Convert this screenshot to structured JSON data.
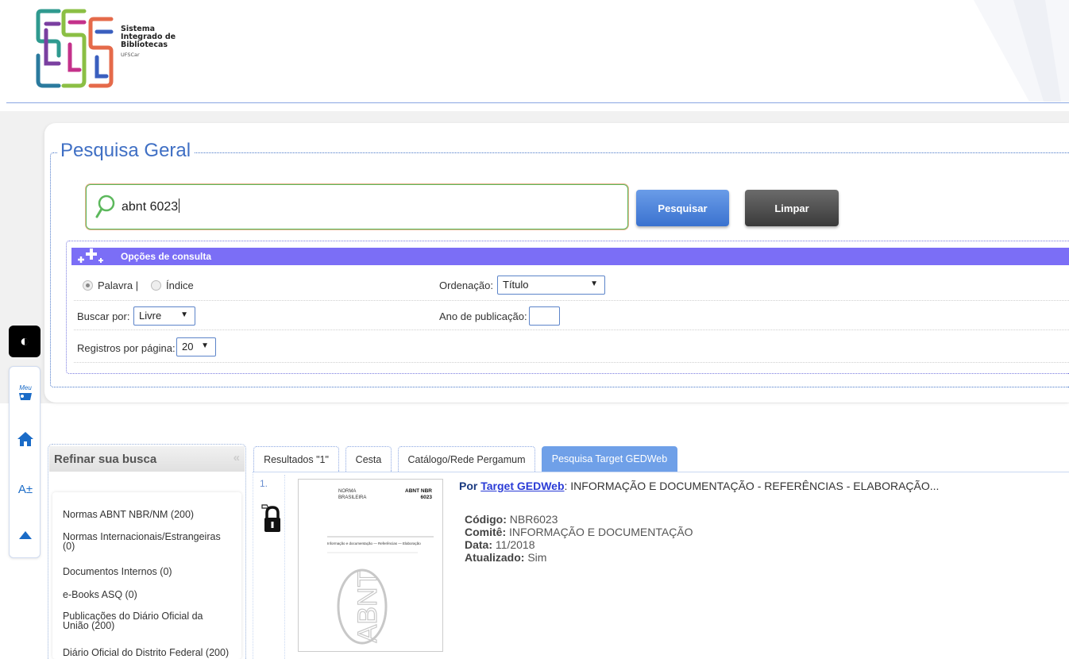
{
  "header": {
    "logo_lines": [
      "Sistema",
      "Integrado de",
      "Bibliotecas"
    ],
    "logo_sub": "UFSCar"
  },
  "search": {
    "legend": "Pesquisa Geral",
    "query": "abnt 6023",
    "search_button": "Pesquisar",
    "clear_button": "Limpar"
  },
  "options": {
    "title": "Opções de consulta",
    "radio_word": "Palavra |",
    "radio_index": "Índice",
    "radio_selected": "Palavra",
    "order_label": "Ordenação:",
    "order_value": "Título",
    "search_by_label": "Buscar por:",
    "search_by_value": "Livre",
    "year_label": "Ano de publicação:",
    "year_value": "",
    "per_page_label": "Registros por página:",
    "per_page_value": "20"
  },
  "toolbar": {
    "contrast": "◐",
    "menu": "Meu",
    "font_size": "A±"
  },
  "refine": {
    "title": "Refinar sua busca",
    "items": [
      "Normas ABNT NBR/NM (200)",
      "Normas Internacionais/Estrangeiras (0)",
      "Documentos Internos (0)",
      "e-Books ASQ (0)",
      "Publicações do Diário Oficial da União (200)",
      "Diário Oficial do Distrito Federal (200)"
    ]
  },
  "tabs": [
    {
      "label": "Resultados \"1\"",
      "active": false
    },
    {
      "label": "Cesta",
      "active": false
    },
    {
      "label": "Catálogo/Rede Pergamum",
      "active": false
    },
    {
      "label": "Pesquisa Target GEDWeb",
      "active": true
    }
  ],
  "result": {
    "number": "1.",
    "by_label": "Por",
    "source_link": "Target GEDWeb",
    "title_rest": ": INFORMAÇÃO E DOCUMENTAÇÃO - REFERÊNCIAS - ELABORAÇÃO...",
    "thumbnail": {
      "norma": "NORMA",
      "brasileira": "BRASILEIRA",
      "code_top": "ABNT NBR",
      "code_num": "6023",
      "doc_title": "Informação e documentação — Referências — Elaboração",
      "logo": "ABNT"
    },
    "fields": [
      {
        "label": "Código:",
        "value": "NBR6023"
      },
      {
        "label": "Comitê:",
        "value": "INFORMAÇÃO E DOCUMENTAÇÃO"
      },
      {
        "label": "Data:",
        "value": "11/2018"
      },
      {
        "label": "Atualizado:",
        "value": "Sim"
      }
    ]
  },
  "colors": {
    "accent_blue": "#3f6fc4",
    "options_bar": "#7b6ef6",
    "search_button": "#3a72cf",
    "clear_button": "#3a3a3a",
    "active_tab": "#6fa0e8"
  }
}
